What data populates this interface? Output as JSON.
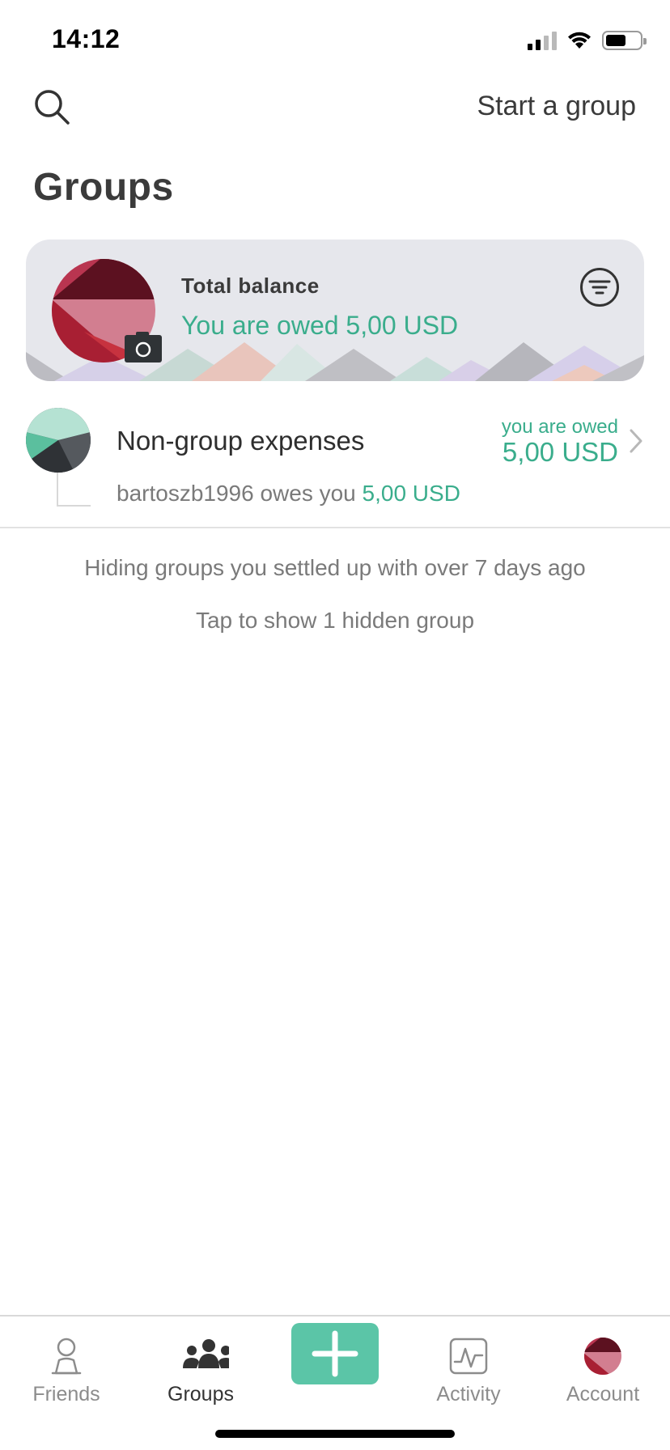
{
  "status_bar": {
    "time": "14:12"
  },
  "header": {
    "search_icon": "search-icon",
    "start_group_label": "Start a group",
    "title": "Groups"
  },
  "balance_card": {
    "label": "Total balance",
    "value": "You are owed 5,00 USD",
    "filter_icon": "filter-icon",
    "camera_icon": "camera-icon"
  },
  "non_group": {
    "name": "Non-group expenses",
    "status_label": "you are owed",
    "status_amount": "5,00 USD",
    "detail_prefix": "bartoszb1996 owes you",
    "detail_amount": "5,00 USD"
  },
  "hidden_info": {
    "hiding_text": "Hiding groups you settled up with over 7 days ago",
    "show_hidden_label": "Tap to show 1 hidden group"
  },
  "tab_bar": {
    "tabs": [
      {
        "label": "Friends",
        "icon": "person-icon",
        "active": false
      },
      {
        "label": "Groups",
        "icon": "group-icon",
        "active": true
      },
      {
        "label": "Activity",
        "icon": "activity-icon",
        "active": false
      },
      {
        "label": "Account",
        "icon": "avatar",
        "active": false
      }
    ],
    "add_icon": "plus-icon"
  },
  "colors": {
    "accent_green": "#5bc5a7",
    "owed_text_green": "#3aad8c",
    "card_background": "#e6e7ec"
  }
}
